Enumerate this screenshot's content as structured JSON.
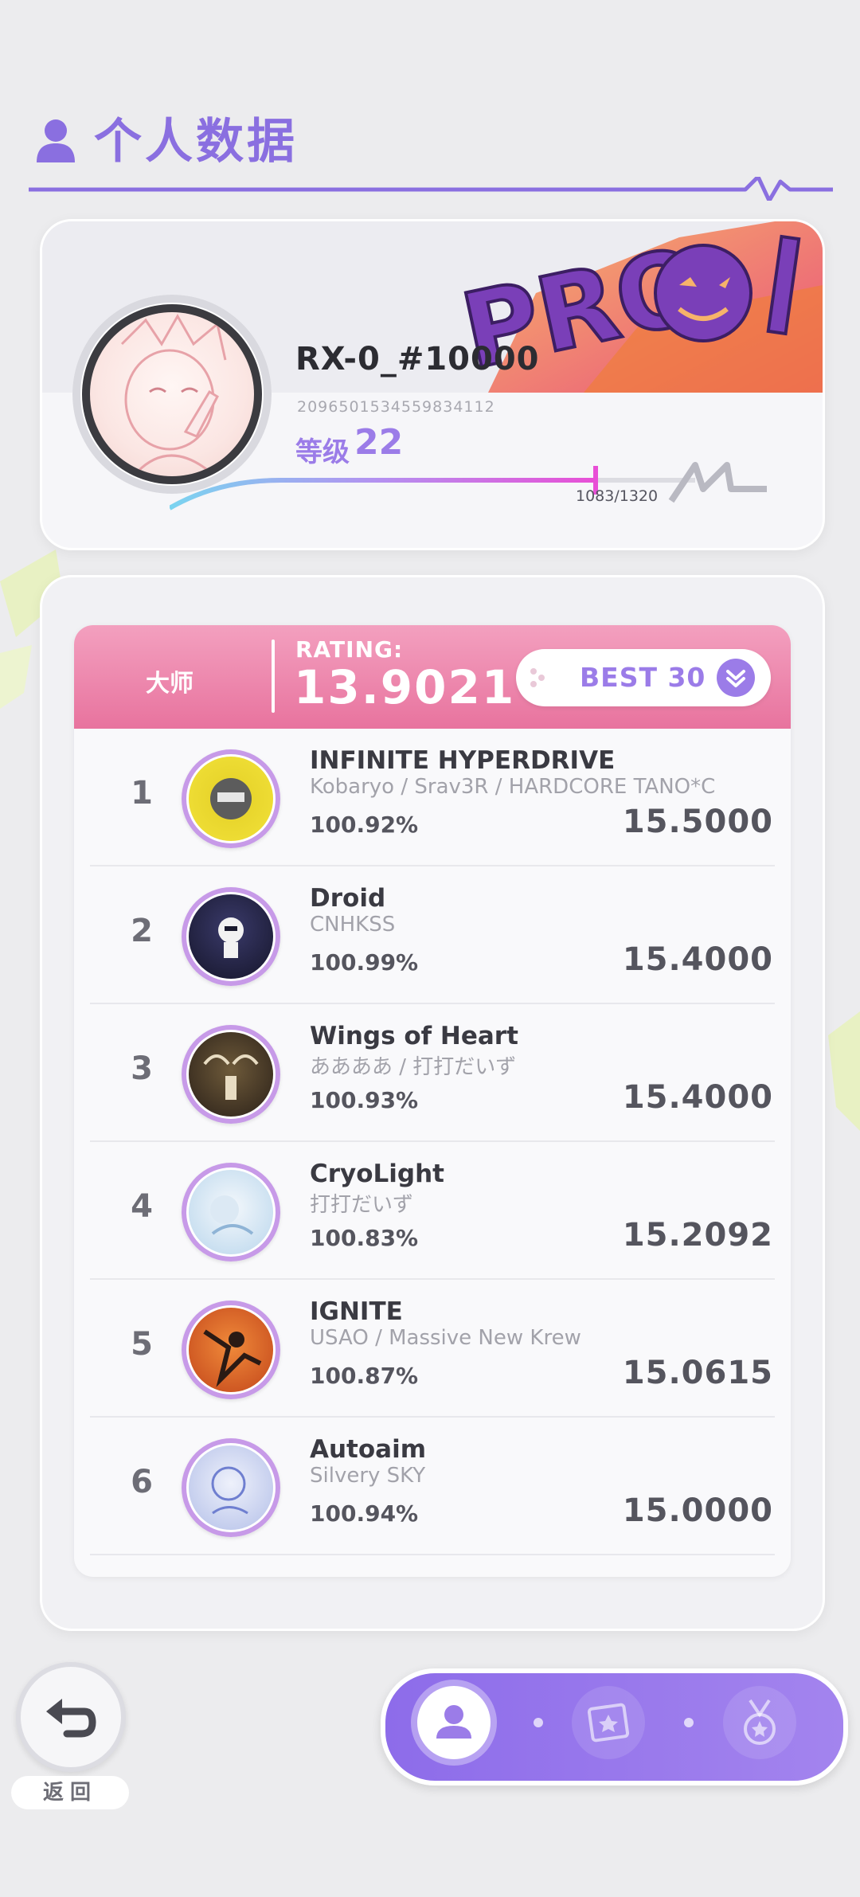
{
  "header": {
    "title": "个人数据"
  },
  "profile": {
    "username": "RX-0_#10000",
    "user_id": "2096501534559834112",
    "level_label": "等级",
    "level": "22",
    "exp_text": "1083/1320",
    "exp_progress": 0.82,
    "banner": "PRO!"
  },
  "rating": {
    "difficulty": "大师",
    "label": "RATING:",
    "value": "13.9021",
    "best_button": "BEST 30"
  },
  "scores": [
    {
      "rank": "1",
      "title": "INFINITE HYPERDRIVE",
      "artist": "Kobaryo / Srav3R / HARDCORE TANO*C",
      "accuracy": "100.92%",
      "rating": "15.5000"
    },
    {
      "rank": "2",
      "title": "Droid",
      "artist": "CNHKSS",
      "accuracy": "100.99%",
      "rating": "15.4000"
    },
    {
      "rank": "3",
      "title": "Wings of Heart",
      "artist": "ああああ / 打打だいず",
      "accuracy": "100.93%",
      "rating": "15.4000"
    },
    {
      "rank": "4",
      "title": "CryoLight",
      "artist": "打打だいず",
      "accuracy": "100.83%",
      "rating": "15.2092"
    },
    {
      "rank": "5",
      "title": "IGNITE",
      "artist": "USAO / Massive New Krew",
      "accuracy": "100.87%",
      "rating": "15.0615"
    },
    {
      "rank": "6",
      "title": "Autoaim",
      "artist": "Silvery SKY",
      "accuracy": "100.94%",
      "rating": "15.0000"
    }
  ],
  "bottom": {
    "back_label": "返回"
  },
  "colors": {
    "accent": "#9b7ce8",
    "rating_header": "#e8739e",
    "nav_bg": "#8d6cea"
  },
  "icons": [
    "user-icon",
    "heartbeat-line-icon",
    "back-arrow-icon",
    "profile-nav-icon",
    "card-nav-icon",
    "medal-nav-icon",
    "chevron-down-icon"
  ]
}
